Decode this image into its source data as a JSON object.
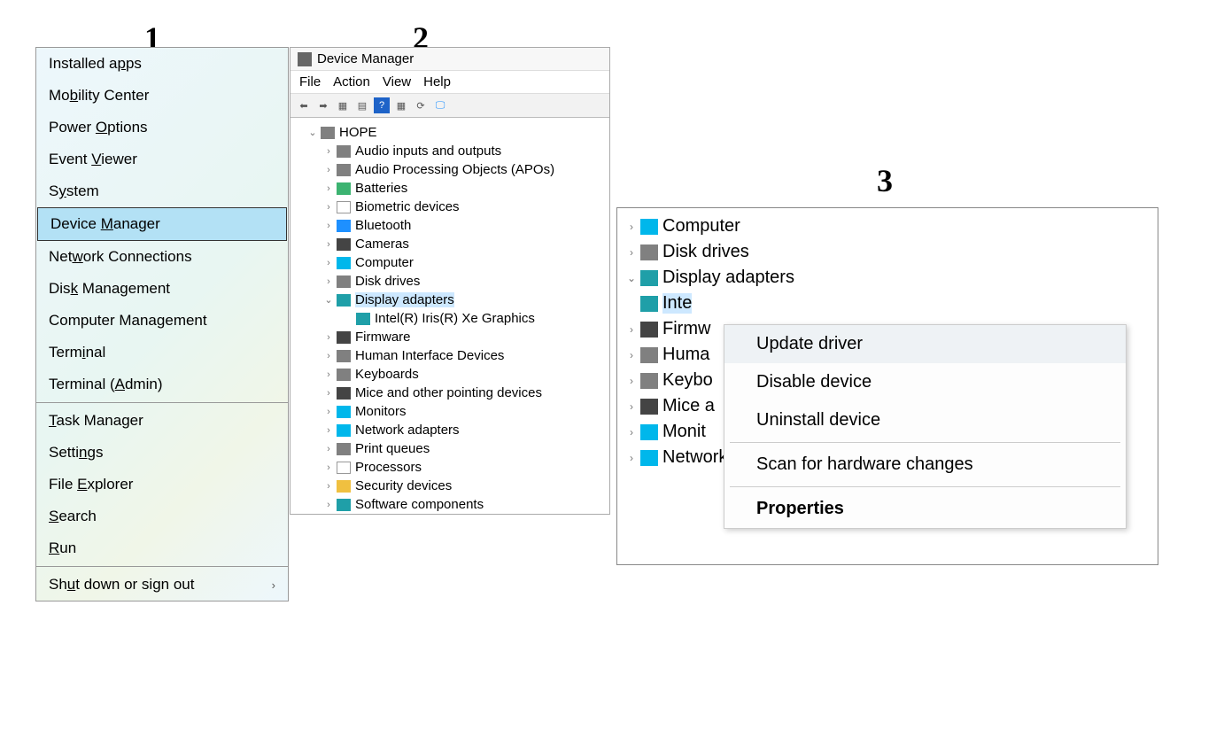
{
  "steps": {
    "one": "1",
    "two": "2",
    "three": "3"
  },
  "panel1": {
    "items": [
      {
        "pre": "Installed a",
        "u": "p",
        "post": "ps"
      },
      {
        "pre": "Mo",
        "u": "b",
        "post": "ility Center"
      },
      {
        "pre": "Power ",
        "u": "O",
        "post": "ptions"
      },
      {
        "pre": "Event ",
        "u": "V",
        "post": "iewer"
      },
      {
        "pre": "S",
        "u": "y",
        "post": "stem"
      },
      {
        "pre": "Device ",
        "u": "M",
        "post": "anager",
        "highlighted": true
      },
      {
        "pre": "Net",
        "u": "w",
        "post": "ork Connections"
      },
      {
        "pre": "Dis",
        "u": "k",
        "post": " Management"
      },
      {
        "pre": "Computer Mana",
        "u": "g",
        "post": "ement"
      },
      {
        "pre": "Term",
        "u": "i",
        "post": "nal"
      },
      {
        "pre": "Terminal (",
        "u": "A",
        "post": "dmin)"
      }
    ],
    "items2": [
      {
        "pre": "",
        "u": "T",
        "post": "ask Manager"
      },
      {
        "pre": "Setti",
        "u": "n",
        "post": "gs"
      },
      {
        "pre": "File ",
        "u": "E",
        "post": "xplorer"
      },
      {
        "pre": "",
        "u": "S",
        "post": "earch"
      },
      {
        "pre": "",
        "u": "R",
        "post": "un"
      }
    ],
    "shutdown": {
      "pre": "Sh",
      "u": "u",
      "post": "t down or sign out"
    }
  },
  "panel2": {
    "title": "Device Manager",
    "menubar": [
      "File",
      "Action",
      "View",
      "Help"
    ],
    "root": "HOPE",
    "nodes": [
      {
        "label": "Audio inputs and outputs",
        "color": "c-gray"
      },
      {
        "label": "Audio Processing Objects (APOs)",
        "color": "c-gray"
      },
      {
        "label": "Batteries",
        "color": "c-green"
      },
      {
        "label": "Biometric devices",
        "color": "c-white"
      },
      {
        "label": "Bluetooth",
        "color": "c-blue"
      },
      {
        "label": "Cameras",
        "color": "c-dark"
      },
      {
        "label": "Computer",
        "color": "c-cyan"
      },
      {
        "label": "Disk drives",
        "color": "c-gray"
      },
      {
        "label": "Display adapters",
        "color": "c-teal",
        "open": true,
        "selected": true
      },
      {
        "label": "Intel(R) Iris(R) Xe Graphics",
        "color": "c-teal",
        "child": true
      },
      {
        "label": "Firmware",
        "color": "c-dark"
      },
      {
        "label": "Human Interface Devices",
        "color": "c-gray"
      },
      {
        "label": "Keyboards",
        "color": "c-gray"
      },
      {
        "label": "Mice and other pointing devices",
        "color": "c-dark"
      },
      {
        "label": "Monitors",
        "color": "c-cyan"
      },
      {
        "label": "Network adapters",
        "color": "c-cyan"
      },
      {
        "label": "Print queues",
        "color": "c-gray"
      },
      {
        "label": "Processors",
        "color": "c-white"
      },
      {
        "label": "Security devices",
        "color": "c-yellow"
      },
      {
        "label": "Software components",
        "color": "c-teal",
        "last": true
      }
    ]
  },
  "panel3": {
    "nodes": [
      {
        "label": "Computer",
        "color": "c-cyan"
      },
      {
        "label": "Disk drives",
        "color": "c-gray"
      },
      {
        "label": "Display adapters",
        "color": "c-teal",
        "open": true
      },
      {
        "label": "Inte",
        "color": "c-teal",
        "child": true,
        "selected": true
      },
      {
        "label": "Firmw",
        "color": "c-dark"
      },
      {
        "label": "Huma",
        "color": "c-gray"
      },
      {
        "label": "Keybo",
        "color": "c-gray"
      },
      {
        "label": "Mice a",
        "color": "c-dark"
      },
      {
        "label": "Monit",
        "color": "c-cyan"
      },
      {
        "label": "Network adapters",
        "color": "c-cyan"
      }
    ],
    "ctx": [
      {
        "label": "Update driver",
        "hover": true
      },
      {
        "label": "Disable device"
      },
      {
        "label": "Uninstall device"
      },
      {
        "sep": true
      },
      {
        "label": "Scan for hardware changes"
      },
      {
        "sep": true
      },
      {
        "label": "Properties",
        "bold": true
      }
    ]
  }
}
